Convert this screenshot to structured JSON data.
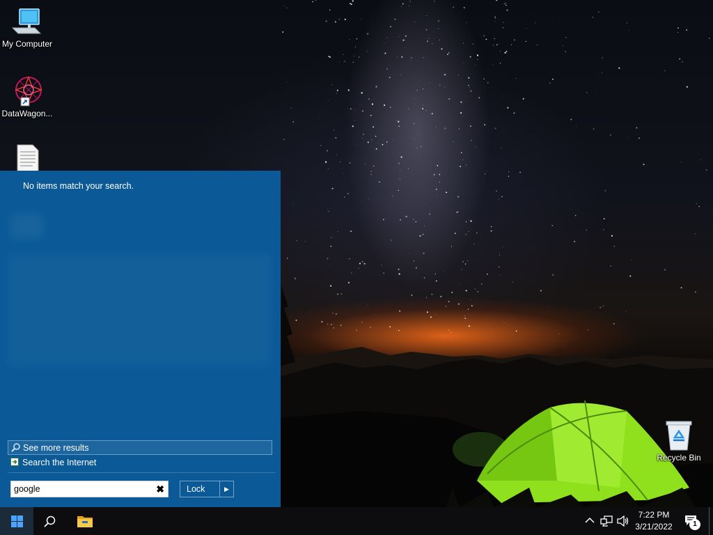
{
  "desktop": {
    "icons": [
      {
        "label": "My Computer",
        "icon": "computer-icon"
      },
      {
        "label": "DataWagon...",
        "icon": "datawagon-icon"
      },
      {
        "label": "",
        "icon": "text-file-icon"
      },
      {
        "label": "Recycle Bin",
        "icon": "recycle-bin-icon"
      }
    ]
  },
  "start_search": {
    "no_results_text": "No items match your search.",
    "see_more_label": "See more results",
    "search_internet_label": "Search the Internet",
    "search_value": "google",
    "clear_icon": "✖",
    "lock_label": "Lock",
    "lock_arrow": "▶",
    "panel_color": "#0b5a97"
  },
  "taskbar": {
    "icons": [
      "windows-start-icon",
      "search-icon",
      "file-explorer-icon"
    ],
    "tray_icons": [
      "chevron-up-icon",
      "network-icon",
      "volume-icon",
      "notification-icon"
    ],
    "time": "7:22 PM",
    "date": "3/21/2022",
    "notification_count": "1"
  }
}
